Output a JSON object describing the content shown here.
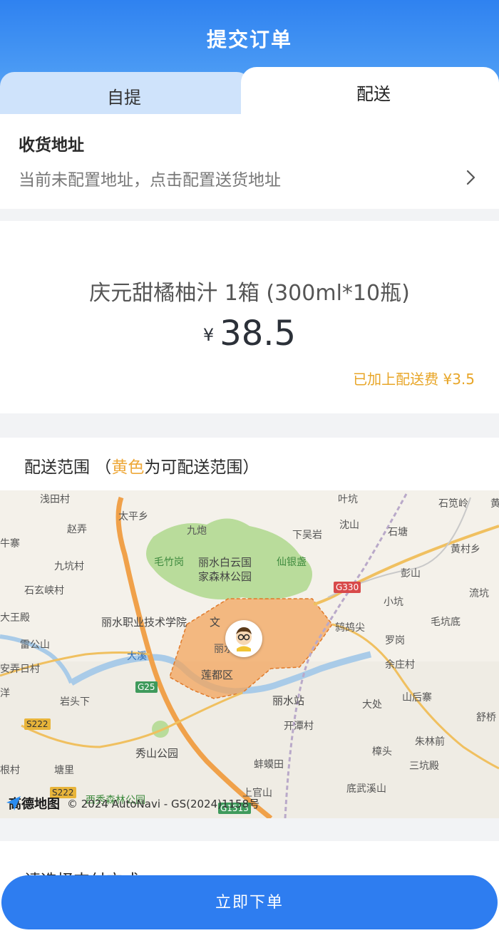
{
  "header": {
    "title": "提交订单"
  },
  "tabs": [
    {
      "label": "自提",
      "active": false
    },
    {
      "label": "配送",
      "active": true
    }
  ],
  "address": {
    "title": "收货地址",
    "hint": "当前未配置地址，点击配置送货地址",
    "chevron_icon": "chevron-right-icon"
  },
  "product": {
    "name": "庆元甜橘柚汁 1箱 (300ml*10瓶)",
    "currency": "¥",
    "price": "38.5",
    "fee_note": "已加上配送费 ¥3.5"
  },
  "delivery_range": {
    "title_prefix": "配送范围 （",
    "title_highlight": "黄色",
    "title_suffix": "为可配送范围）",
    "highlight_color": "#eea83a"
  },
  "map": {
    "labels": {
      "qiantiancun": "浅田村",
      "taipingxiang": "太平乡",
      "jiupao": "九炮",
      "yekeng": "叶坑",
      "shancunling": "石笕岭",
      "huang": "黄",
      "zhaonong": "赵弄",
      "niuzhai": "牛寨",
      "xiawuyan": "下吴岩",
      "chenshan": "沈山",
      "shitang": "石塘",
      "huangcunxiang": "黄村乡",
      "maozhugang": "毛竹岗",
      "jiukengcun": "九坑村",
      "park_white_cloud_1": "丽水白云国",
      "park_white_cloud_2": "家森林公园",
      "xianyinji": "仙银盏",
      "pengshan": "彭山",
      "shixuanxiacun": "石玄峡村",
      "liukeng": "流坑",
      "xiaokeng": "小坑",
      "dawangdian": "大王殿",
      "college": "丽水职业技术学院",
      "college_wen": "文",
      "maokengdi": "毛坑底",
      "qufangjian": "鸫鸪尖",
      "luogang": "罗岗",
      "leigongshan": "雷公山",
      "lishui_college": "丽水学院",
      "yuzhuangcun": "余庄村",
      "jiaorirum": "安弄日村",
      "daxi": "大溪",
      "liandu": "莲都区",
      "lishuizhan": "丽水站",
      "shanhouzhai": "山后寨",
      "yang": "洋",
      "yantouxia": "岩头下",
      "dachu": "大处",
      "shuqiao": "舒桥",
      "kaitancun": "开潭村",
      "zhulinqian": "朱林前",
      "xiushan": "秀山公园",
      "zhangtou": "樟头",
      "sankengdian": "三坑殿",
      "gencun": "根村",
      "tangli": "塘里",
      "bangmotian": "蚌蟆田",
      "diwuxishan": "底武溪山",
      "xixiu": "西秀森林公园",
      "shangguanshan": "上官山"
    },
    "roads": {
      "g330": "G330",
      "g25": "G25",
      "s222": "S222",
      "s222b": "S222",
      "g1513": "G1513"
    },
    "brand": "高德地图",
    "copyright": "© 2024 AutoNavi - GS(2024)1158号",
    "range_fill_color": "#f3a45c",
    "park_color": "#b9dc9b"
  },
  "payment": {
    "title": "请选择支付方式"
  },
  "submit": {
    "label": "立即下单"
  }
}
